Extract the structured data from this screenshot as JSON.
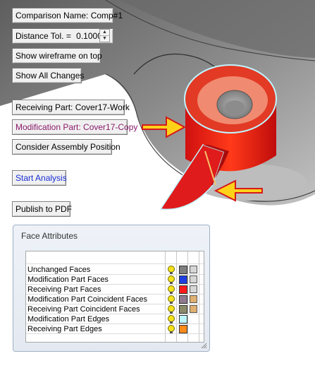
{
  "controls": {
    "comparison_name": "Comparison Name: Comp#1",
    "distance_label": "Distance Tol. =",
    "distance_value": "0.1000",
    "show_wireframe": "Show wireframe on top",
    "show_all_changes": "Show All Changes",
    "receiving_part": "Receiving Part: Cover17-Work",
    "modification_part": "Modification Part: Cover17-Copy",
    "consider_assembly": "Consider Assembly Position",
    "start_analysis": "Start Analysis",
    "publish_pdf": "Publish to PDF"
  },
  "face_attributes": {
    "title": "Face Attributes",
    "rows": [
      {
        "label": "Unchanged Faces",
        "color": "#7f7f7f",
        "icon": "cube-icon"
      },
      {
        "label": "Modification Part Faces",
        "color": "#1f3fe0",
        "icon": "cube-icon"
      },
      {
        "label": "Receiving Part Faces",
        "color": "#ff1a1a",
        "icon": "cube-icon"
      },
      {
        "label": "Modification Part Coincident Faces",
        "color": "#8f7a8f",
        "icon": "coincident-cube-icon"
      },
      {
        "label": "Receiving  Part Coincident Faces",
        "color": "#8a8a6a",
        "icon": "coincident-cube-icon"
      },
      {
        "label": "Modification Part Edges",
        "color": "#bff5ff",
        "icon": ""
      },
      {
        "label": "Receiving  Part Edges",
        "color": "#ff8a1a",
        "icon": ""
      }
    ]
  }
}
